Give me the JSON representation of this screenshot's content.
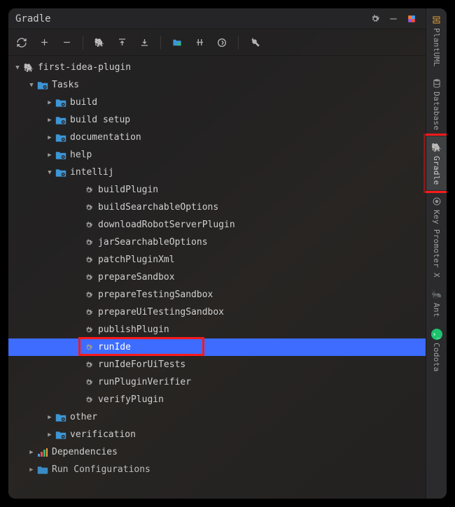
{
  "panel": {
    "title": "Gradle"
  },
  "toolbar": {
    "refresh": "↻",
    "add": "+",
    "remove": "–"
  },
  "tree": {
    "project": "first-idea-plugin",
    "tasks_label": "Tasks",
    "groups": {
      "build": "build",
      "build_setup": "build setup",
      "documentation": "documentation",
      "help": "help",
      "intellij": "intellij",
      "other": "other",
      "verification": "verification"
    },
    "intellij_tasks": [
      "buildPlugin",
      "buildSearchableOptions",
      "downloadRobotServerPlugin",
      "jarSearchableOptions",
      "patchPluginXml",
      "prepareSandbox",
      "prepareTestingSandbox",
      "prepareUiTestingSandbox",
      "publishPlugin",
      "runIde",
      "runIdeForUiTests",
      "runPluginVerifier",
      "verifyPlugin"
    ],
    "selected_task": "runIde",
    "dependencies": "Dependencies",
    "run_configs": "Run Configurations"
  },
  "rail": {
    "plantuml": "PlantUML",
    "database": "Database",
    "gradle": "Gradle",
    "keypromoter": "Key Promoter X",
    "ant": "Ant",
    "codota": "Codota"
  }
}
